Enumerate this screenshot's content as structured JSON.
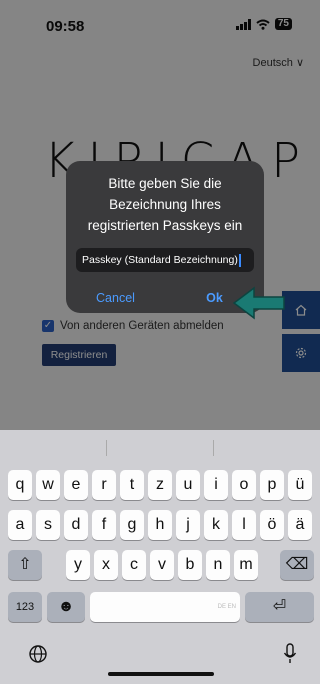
{
  "status": {
    "time": "09:58",
    "battery": "75"
  },
  "page": {
    "language": "Deutsch ∨",
    "logo": "KIPICAP",
    "checkbox_label": "Von anderen Geräten abmelden",
    "register_label": "Registrieren"
  },
  "dialog": {
    "title": "Bitte geben Sie die Bezeichnung Ihres registrierten Passkeys ein",
    "input_value": "Passkey (Standard Bezeichnung)",
    "cancel_label": "Cancel",
    "ok_label": "Ok"
  },
  "keyboard": {
    "row1": [
      "q",
      "w",
      "e",
      "r",
      "t",
      "z",
      "u",
      "i",
      "o",
      "p",
      "ü"
    ],
    "row2": [
      "a",
      "s",
      "d",
      "f",
      "g",
      "h",
      "j",
      "k",
      "l",
      "ö",
      "ä"
    ],
    "row3": [
      "y",
      "x",
      "c",
      "v",
      "b",
      "n",
      "m"
    ],
    "numbers_label": "123",
    "space_hint": "DE EN"
  },
  "colors": {
    "accent": "#4b9bff",
    "brand": "#1f4e94",
    "arrow": "#1a7a73"
  }
}
